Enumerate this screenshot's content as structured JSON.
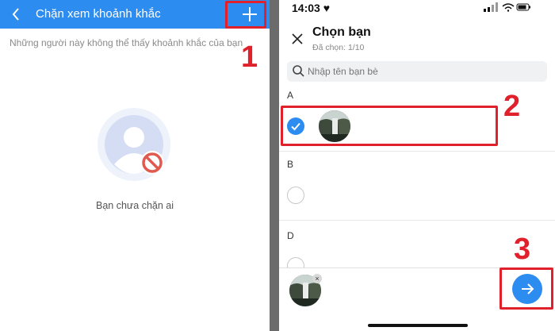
{
  "left": {
    "back_icon": "chevron-left-icon",
    "title": "Chặn xem khoảnh khắc",
    "add_icon": "plus-icon",
    "subtitle": "Những người này không thể thấy khoảnh khắc của bạn",
    "empty_text": "Bạn chưa chặn ai",
    "header_color": "#2d8cf0"
  },
  "right": {
    "status": {
      "time": "14:03 ♥"
    },
    "header": {
      "title": "Chọn bạn",
      "count": "Đã chọn: 1/10",
      "close_icon": "close-icon"
    },
    "search": {
      "placeholder": "Nhập tên bạn bè"
    },
    "sections": [
      {
        "letter": "A"
      },
      {
        "letter": "B"
      },
      {
        "letter": "D"
      }
    ],
    "next_icon": "arrow-right-icon",
    "accent_color": "#2d8cf0"
  },
  "annotations": {
    "step1": "1",
    "step2": "2",
    "step3": "3",
    "color": "#e0202a"
  }
}
